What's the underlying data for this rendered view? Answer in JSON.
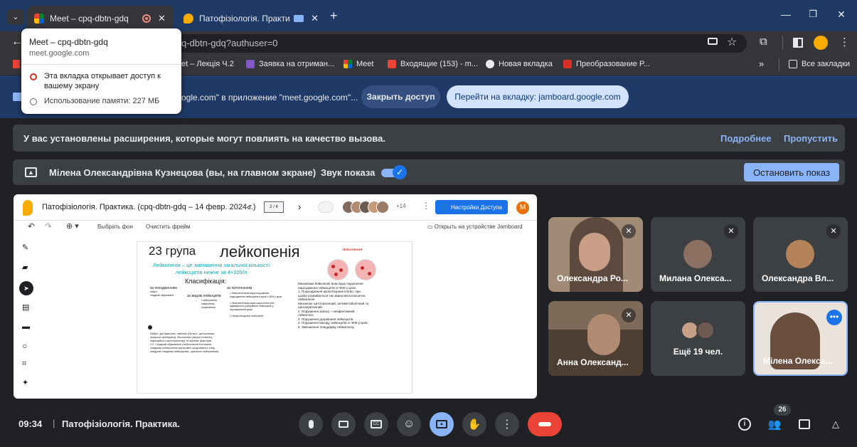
{
  "browser": {
    "tabs": [
      {
        "title": "Meet – cpq-dbtn-gdq"
      },
      {
        "title": "Патофізіологія. Практика."
      }
    ],
    "url": "q-dbtn-gdq?authuser=0",
    "hover_card": {
      "title": "Meet – cpq-dbtn-gdq",
      "domain": "meet.google.com",
      "sharing": "Эта вкладка открывает доступ к вашему экрану",
      "memory": "Использование памяти: 227 МБ"
    },
    "bookmarks": [
      {
        "label": "et – Лекція Ч.2",
        "icon": "meet-icon"
      },
      {
        "label": "Заявка на отриман...",
        "icon": "form-icon"
      },
      {
        "label": "Meet",
        "icon": "meet-icon"
      },
      {
        "label": "Входящие (153) - m...",
        "icon": "gmail-icon"
      },
      {
        "label": "Новая вкладка",
        "icon": "chrome-icon"
      },
      {
        "label": "Преобразование P...",
        "icon": "pdf-icon"
      }
    ],
    "all_bookmarks": "Все закладки",
    "more_bookmarks": "»"
  },
  "share_bar": {
    "message": "ogle.com\" в приложение \"meet.google.com\"...",
    "stop_button": "Закрыть доступ",
    "switch_button": "Перейти на вкладку: jamboard.google.com"
  },
  "meet": {
    "extensions_notice": "У вас установлены расширения, которые могут повлиять на качество вызова.",
    "more_link": "Подробнее",
    "skip_link": "Пропустить",
    "presenter": "Мілена Олександрівна Кузнецова (вы, на главном экране)",
    "sound_label": "Звук показа",
    "stop_share_button": "Остановить показ",
    "time": "09:34",
    "separator": "|",
    "meeting_title": "Патофізіологія. Практика.",
    "participant_count": "26",
    "colors": {
      "accent": "#8ab4f8",
      "end_call": "#ea4335",
      "present_active": "#8ab4f8"
    }
  },
  "jamboard": {
    "doc_title": "Патофізіологія. Практика. (cpq-dbtn-gdq – 14 февр. 2024 г.)",
    "page_indicator": "2 / 4",
    "extra_users": "+14",
    "access_button": "Настройки Доступа",
    "avatar_letter": "M",
    "set_background": "Выбрать фон",
    "clear_frame": "Очистить фрейм",
    "open_on_device": "Открыть на устройстве Jamboard",
    "frame": {
      "group": "23 група",
      "title": "лейкопенія",
      "leukopenia_label": "ЛЕЙКОПЕНИЯ",
      "definition": "Лейкопенія – це зменшення загальної кількості лейкоцитів нижче за 4×109/л",
      "classification": "Класифікація:",
      "by_origin": "за походженням",
      "origin_types": "набуті\nспадкові обумовлені",
      "by_type": "за видом лейкоцитів",
      "by_pathogenesis": "за патогенезом",
      "type_list": "• нейтропенія\n  лімфопенія\n  еозинопенія",
      "patho_list": "• Лейкопенії внаслідок порушення надходження лейкоцитів в кров з ЧКМ у кров\n\n• Лейкопенії внаслідок скорочення або підвищеного руйнування лейкоцитів у периферичній крові\n\n• Перерозподільні лейкопенії",
      "mechanisms": "Механізми Лейкопенії внаслідок порушення надходження лейкоцитів із ЧКМ у кров:\n1. Пошкодження кровотворних клітин, при цьому розвивається так звана мієлотоксична лейкопенія.\nМеханізм: цитотоксичний, антиметаболічний та циоскеритичний\n2. Порушення запасу – неефективний лейкопоез\n3. Порушення дозрівання лейкоцитів.\n4. Порушення виходу лейкоцитів із ЧКМ у кров.\n5. Зменшення плацдарму лейкопоезу.",
      "acquired": "Набуті: дія фізичних, хімічних (бензол, цитостатики, лікарські препарати), біологічних (віруси гепатиту, інфекційного мононуклеозу) та імунних факторів.\n1.2. Спадкові обумовлені (нейтропенія Костмана, спадкова нейтропенія аутосомно-рецесивного типу, синдром «ледачих лейкоцитів», циклічна нейтропенія)"
    }
  },
  "participants": [
    {
      "name": "Олександра Ро...",
      "muted": true
    },
    {
      "name": "Милана Олекса...",
      "muted": true
    },
    {
      "name": "Олександра Вл...",
      "muted": true
    },
    {
      "name": "Анна Олександ...",
      "muted": true
    },
    {
      "name": "Ещё 19 чел.",
      "muted": false
    },
    {
      "name": "Мілена Олекса...",
      "muted": false
    }
  ]
}
